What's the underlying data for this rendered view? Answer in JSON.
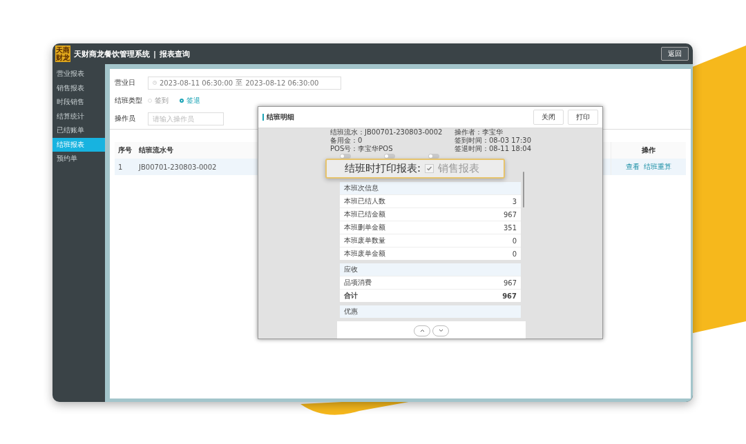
{
  "header": {
    "logo_lines": [
      "天商",
      "财龙"
    ],
    "app_name": "天财商龙餐饮管理系统",
    "separator": "|",
    "page_title": "报表查询",
    "back_button": "返回"
  },
  "sidebar": {
    "items": [
      {
        "label": "营业报表",
        "selected": false
      },
      {
        "label": "销售报表",
        "selected": false
      },
      {
        "label": "时段销售",
        "selected": false
      },
      {
        "label": "结算统计",
        "selected": false
      },
      {
        "label": "已结账单",
        "selected": false
      },
      {
        "label": "结班报表",
        "selected": true
      },
      {
        "label": "预约单",
        "selected": false
      }
    ]
  },
  "filters": {
    "date": {
      "label": "营业日",
      "start": "2023-08-11 06:30:00",
      "to": "至",
      "end": "2023-08-12 06:30:00"
    },
    "shift_type": {
      "label": "结班类型",
      "options": [
        {
          "label": "签到",
          "selected": false
        },
        {
          "label": "签退",
          "selected": true
        }
      ]
    },
    "operator": {
      "label": "操作员",
      "placeholder": "请输入操作员"
    }
  },
  "table": {
    "columns": [
      "序号",
      "结班流水号",
      "操作"
    ],
    "rows": [
      {
        "cells": [
          "1",
          "JB00701-230803-0002"
        ],
        "actions": [
          "查看",
          "结班重算"
        ]
      }
    ]
  },
  "modal": {
    "title": "结班明细",
    "buttons": [
      "关闭",
      "打印"
    ],
    "info_left": [
      "结班流水：JB00701-230803-0002",
      "备用金：0",
      "POS号：李宝华POS"
    ],
    "info_right": [
      "操作者：李宝华",
      "签到时间：08-03 17:30",
      "签退时间：08-11 18:04"
    ],
    "toggles": [
      {
        "on": false
      },
      {
        "on": false
      },
      {
        "on": false
      }
    ],
    "sections": [
      {
        "title": "本班次信息",
        "rows": [
          {
            "label": "本班已结人数",
            "value": "3",
            "bold": false
          },
          {
            "label": "本班已结金额",
            "value": "967",
            "bold": false
          },
          {
            "label": "本班删单金额",
            "value": "351",
            "bold": false
          },
          {
            "label": "本班废单数量",
            "value": "0",
            "bold": false
          },
          {
            "label": "本班废单金额",
            "value": "0",
            "bold": false
          }
        ]
      },
      {
        "title": "应收",
        "rows": [
          {
            "label": "品项消费",
            "value": "967",
            "bold": false
          },
          {
            "label": "合计",
            "value": "967",
            "bold": true
          }
        ]
      },
      {
        "title": "优惠"
      }
    ]
  },
  "callout": {
    "label": "结班时打印报表:",
    "checked": true,
    "option": "销售报表",
    "option_disabled": true
  }
}
